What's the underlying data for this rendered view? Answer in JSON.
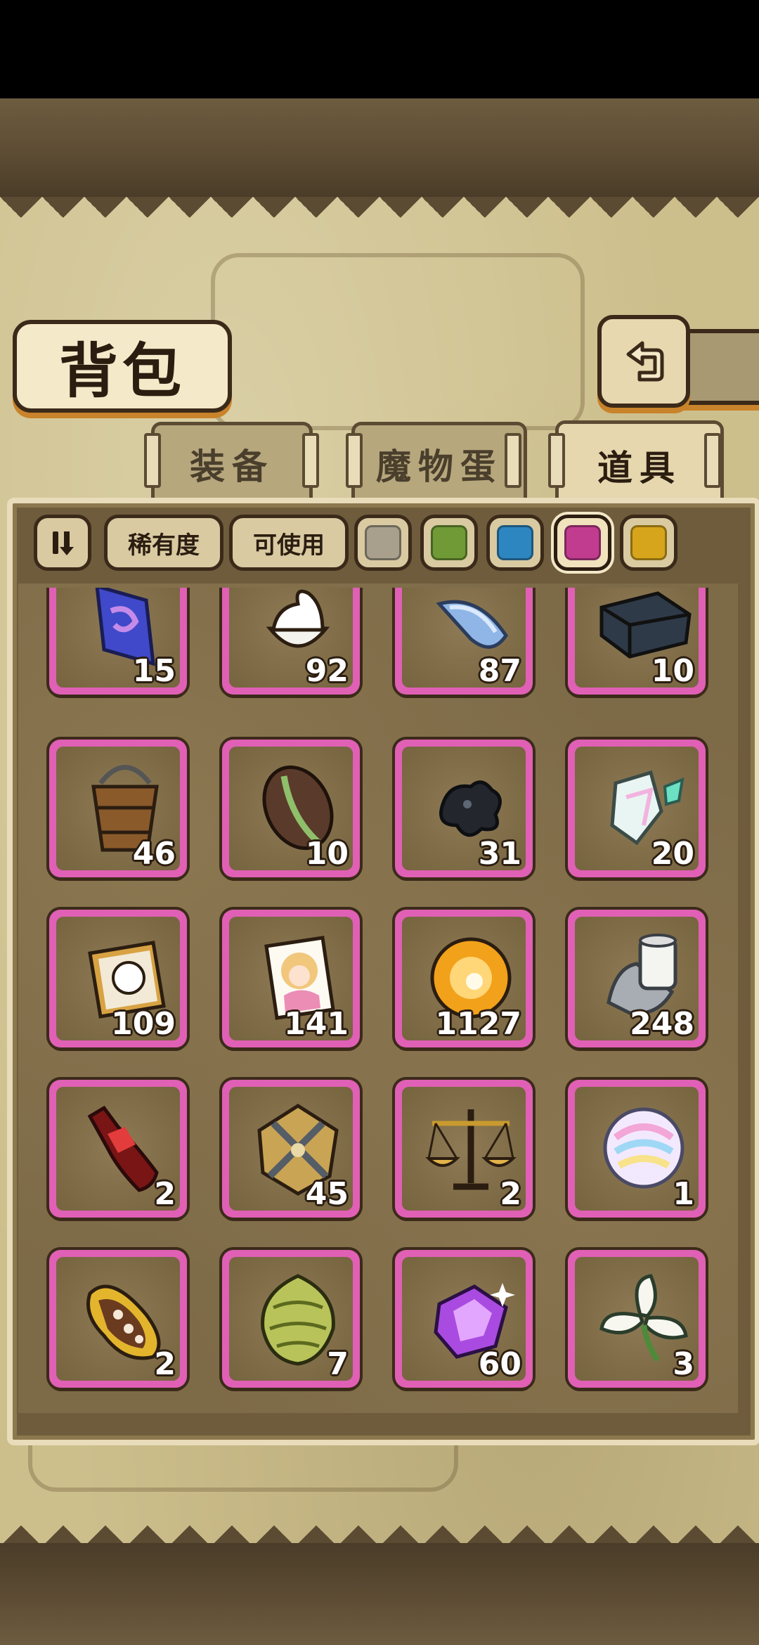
{
  "title": "背包",
  "tabs": [
    {
      "label": "装备",
      "active": false
    },
    {
      "label": "魔物蛋",
      "active": false
    },
    {
      "label": "道具",
      "active": true
    }
  ],
  "filters": {
    "sort_icon": "sort-icon",
    "rarity_label": "稀有度",
    "usable_label": "可使用",
    "rarity_swatches": [
      {
        "name": "gray",
        "color": "#a8a08c",
        "selected": false
      },
      {
        "name": "green",
        "color": "#6f9a36",
        "selected": false
      },
      {
        "name": "blue",
        "color": "#2e86c1",
        "selected": false
      },
      {
        "name": "purple",
        "color": "#c13c8e",
        "selected": true
      },
      {
        "name": "gold",
        "color": "#d6a51c",
        "selected": false
      }
    ]
  },
  "items": [
    {
      "icon": "crystal-card-icon",
      "count": "15"
    },
    {
      "icon": "whipped-cream-icon",
      "count": "92"
    },
    {
      "icon": "ice-shard-icon",
      "count": "87"
    },
    {
      "icon": "metal-crate-icon",
      "count": "10"
    },
    {
      "icon": "wooden-bucket-icon",
      "count": "46"
    },
    {
      "icon": "seed-icon",
      "count": "10"
    },
    {
      "icon": "black-ore-icon",
      "count": "31"
    },
    {
      "icon": "prism-crystal-icon",
      "count": "20"
    },
    {
      "icon": "portrait-frame-icon",
      "count": "109"
    },
    {
      "icon": "character-card-icon",
      "count": "141"
    },
    {
      "icon": "golden-orb-icon",
      "count": "1127"
    },
    {
      "icon": "paper-roll-icon",
      "count": "248"
    },
    {
      "icon": "soda-bottle-icon",
      "count": "2"
    },
    {
      "icon": "crossed-swords-emblem-icon",
      "count": "45"
    },
    {
      "icon": "balance-scale-icon",
      "count": "2"
    },
    {
      "icon": "rainbow-fluff-icon",
      "count": "1"
    },
    {
      "icon": "cacao-pod-icon",
      "count": "2"
    },
    {
      "icon": "hop-cone-icon",
      "count": "7"
    },
    {
      "icon": "purple-gem-icon",
      "count": "60"
    },
    {
      "icon": "white-flower-icon",
      "count": "3"
    }
  ],
  "colors": {
    "item_frame_purple": "#e060b5",
    "panel": "#7d6a47",
    "parchment": "#cdbf8c"
  }
}
